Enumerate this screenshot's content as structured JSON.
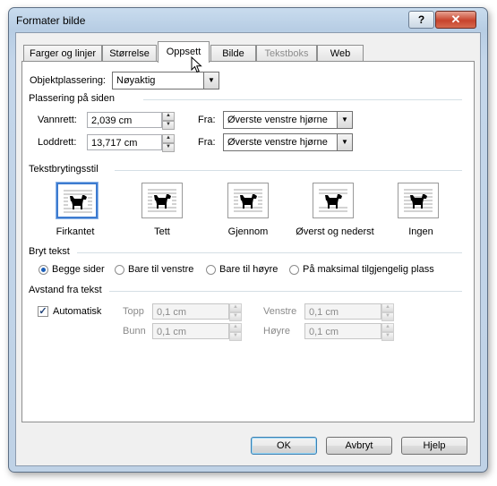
{
  "window": {
    "title": "Formater bilde",
    "help_label": "?",
    "close_label": "✕"
  },
  "tabs": [
    {
      "label": "Farger og linjer",
      "state": "normal"
    },
    {
      "label": "Størrelse",
      "state": "normal"
    },
    {
      "label": "Oppsett",
      "state": "active"
    },
    {
      "label": "Bilde",
      "state": "normal"
    },
    {
      "label": "Tekstboks",
      "state": "disabled"
    },
    {
      "label": "Web",
      "state": "normal"
    }
  ],
  "objektplassering": {
    "label": "Objektplassering:",
    "value": "Nøyaktig"
  },
  "plassering": {
    "header": "Plassering på siden",
    "vannrett_label": "Vannrett:",
    "vannrett_value": "2,039 cm",
    "loddrett_label": "Loddrett:",
    "loddrett_value": "13,717 cm",
    "fra_label": "Fra:",
    "fra1_value": "Øverste venstre hjørne",
    "fra2_value": "Øverste venstre hjørne"
  },
  "wrapping": {
    "header": "Tekstbrytingsstil",
    "options": [
      "Firkantet",
      "Tett",
      "Gjennom",
      "Øverst og nederst",
      "Ingen"
    ],
    "selected": "Firkantet"
  },
  "bryt": {
    "header": "Bryt tekst",
    "options": [
      "Begge sider",
      "Bare til venstre",
      "Bare til høyre",
      "På maksimal tilgjengelig plass"
    ],
    "selected": "Begge sider"
  },
  "avstand": {
    "header": "Avstand fra tekst",
    "auto_label": "Automatisk",
    "auto_checked": true,
    "topp_label": "Topp",
    "topp_value": "0,1 cm",
    "bunn_label": "Bunn",
    "bunn_value": "0,1 cm",
    "venstre_label": "Venstre",
    "venstre_value": "0,1 cm",
    "hoyre_label": "Høyre",
    "hoyre_value": "0,1 cm"
  },
  "buttons": {
    "ok": "OK",
    "cancel": "Avbryt",
    "help": "Hjelp"
  },
  "icons": {
    "wrap_icon": "dog-picture-icon",
    "cursor": "mouse-pointer-icon"
  },
  "colors": {
    "accent": "#3d7bd0",
    "title_bar": "#c9dcee"
  }
}
